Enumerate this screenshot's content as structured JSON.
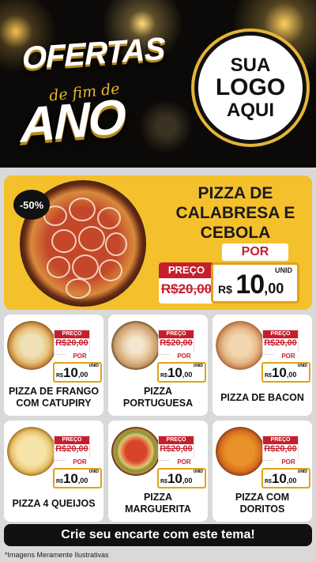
{
  "banner": {
    "title_line1": "OFERTAS",
    "title_line2": "de fim de",
    "title_line3": "ANO",
    "logo_line1": "SUA",
    "logo_line2": "LOGO",
    "logo_line3": "AQUI"
  },
  "featured": {
    "discount": "-50%",
    "name_line1": "PIZZA DE",
    "name_line2": "CALABRESA E",
    "name_line3": "CEBOLA",
    "preco_label": "PREÇO",
    "old_price": "R$20,00",
    "por_label": "POR",
    "unit": "UNID",
    "currency": "R$",
    "price_int": "10",
    "price_cents": ",00"
  },
  "products": [
    {
      "line1": "PIZZA DE FRANGO",
      "line2": "COM CATUPIRY",
      "preco_label": "PREÇO",
      "old_price": "R$20,00",
      "por_label": "POR",
      "unit": "UNID",
      "currency": "R$",
      "price_int": "10",
      "price_cents": ",00"
    },
    {
      "line1": "PIZZA",
      "line2": "PORTUGUESA",
      "preco_label": "PREÇO",
      "old_price": "R$20,00",
      "por_label": "POR",
      "unit": "UNID",
      "currency": "R$",
      "price_int": "10",
      "price_cents": ",00"
    },
    {
      "line1": "PIZZA DE BACON",
      "line2": "",
      "preco_label": "PREÇO",
      "old_price": "R$20,00",
      "por_label": "POR",
      "unit": "UNID",
      "currency": "R$",
      "price_int": "10",
      "price_cents": ",00"
    },
    {
      "line1": "PIZZA 4 QUEIJOS",
      "line2": "",
      "preco_label": "PREÇO",
      "old_price": "R$20,00",
      "por_label": "POR",
      "unit": "UNID",
      "currency": "R$",
      "price_int": "10",
      "price_cents": ",00"
    },
    {
      "line1": "PIZZA",
      "line2": "MARGUERITA",
      "preco_label": "PREÇO",
      "old_price": "R$20,00",
      "por_label": "POR",
      "unit": "UNID",
      "currency": "R$",
      "price_int": "10",
      "price_cents": ",00"
    },
    {
      "line1": "PIZZA COM",
      "line2": "DORITOS",
      "preco_label": "PREÇO",
      "old_price": "R$20,00",
      "por_label": "POR",
      "unit": "UNID",
      "currency": "R$",
      "price_int": "10",
      "price_cents": ",00"
    }
  ],
  "cta": {
    "label": "Crie seu encarte com este tema!"
  },
  "footer": {
    "note": "*Imagens Meramente Ilustrativas"
  },
  "colors": {
    "accent": "#f4c02c",
    "price_red": "#c51e2c",
    "gold_border": "#e0a21a"
  }
}
